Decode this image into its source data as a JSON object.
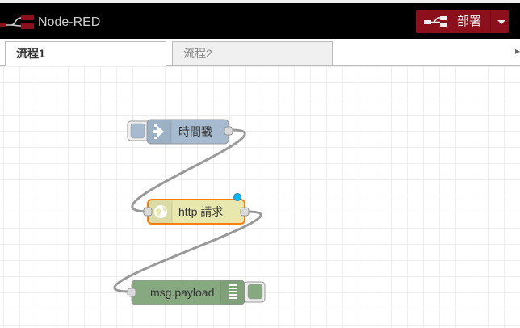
{
  "header": {
    "title": "Node-RED",
    "deploy_label": "部署"
  },
  "tabs": [
    {
      "label": "流程1",
      "active": true
    },
    {
      "label": "流程2",
      "active": false
    }
  ],
  "nodes": [
    {
      "label": "時間戳",
      "type": "inject",
      "color": "#a6bbcf"
    },
    {
      "label": "http 請求",
      "type": "http request",
      "color": "#e7e7ae",
      "selected": true,
      "changed": true
    },
    {
      "label": "msg.payload",
      "type": "debug",
      "color": "#87a980"
    }
  ],
  "colors": {
    "header_bg": "#000000",
    "deploy_bg": "#8c101c",
    "selection": "#ff7f0e",
    "wire": "#999999"
  }
}
